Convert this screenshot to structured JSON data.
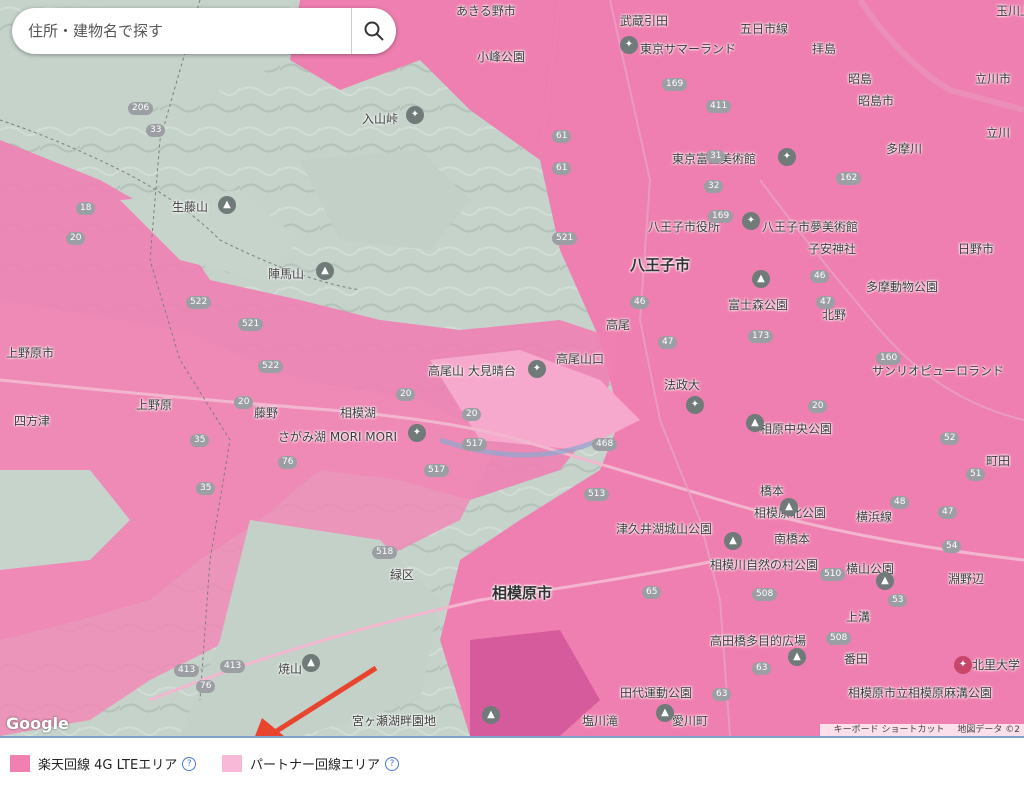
{
  "search": {
    "placeholder": "住所・建物名で探す"
  },
  "colors": {
    "coverage_4g": "#f080b0",
    "partner": "#f8b8d8",
    "arrow": "#e8442e"
  },
  "places": [
    {
      "name": "あきる野市",
      "type": "city-small"
    },
    {
      "name": "武蔵引田",
      "type": "station"
    },
    {
      "name": "五日市線",
      "type": "line"
    },
    {
      "name": "東京サマーランド",
      "type": "poi"
    },
    {
      "name": "拝島",
      "type": "station"
    },
    {
      "name": "昭島",
      "type": "station"
    },
    {
      "name": "昭島市",
      "type": "city-small"
    },
    {
      "name": "立川市",
      "type": "city-small"
    },
    {
      "name": "小峰公園",
      "type": "poi"
    },
    {
      "name": "入山峠",
      "type": "poi"
    },
    {
      "name": "東京富士美術館",
      "type": "poi"
    },
    {
      "name": "生藤山",
      "type": "mountain"
    },
    {
      "name": "八王子市役所",
      "type": "poi"
    },
    {
      "name": "八王子市夢美術館",
      "type": "poi"
    },
    {
      "name": "子安神社",
      "type": "poi"
    },
    {
      "name": "日野市",
      "type": "city-small"
    },
    {
      "name": "陣馬山",
      "type": "mountain"
    },
    {
      "name": "八王子市",
      "type": "city"
    },
    {
      "name": "多摩動物公園",
      "type": "poi"
    },
    {
      "name": "富士森公園",
      "type": "poi"
    },
    {
      "name": "高尾",
      "type": "station"
    },
    {
      "name": "北野",
      "type": "station"
    },
    {
      "name": "上野原市",
      "type": "city-small"
    },
    {
      "name": "高尾山 大見晴台",
      "type": "poi"
    },
    {
      "name": "高尾山口",
      "type": "station"
    },
    {
      "name": "サンリオピューロランド",
      "type": "poi"
    },
    {
      "name": "法政大",
      "type": "poi"
    },
    {
      "name": "上野原",
      "type": "station"
    },
    {
      "name": "藤野",
      "type": "station"
    },
    {
      "name": "相模湖",
      "type": "station"
    },
    {
      "name": "四方津",
      "type": "station"
    },
    {
      "name": "さがみ湖 MORI MORI",
      "type": "poi"
    },
    {
      "name": "相原中央公園",
      "type": "poi"
    },
    {
      "name": "町田",
      "type": "city-small"
    },
    {
      "name": "橋本",
      "type": "station"
    },
    {
      "name": "相模原北公園",
      "type": "poi"
    },
    {
      "name": "横浜線",
      "type": "line"
    },
    {
      "name": "津久井湖城山公園",
      "type": "poi"
    },
    {
      "name": "南橋本",
      "type": "station"
    },
    {
      "name": "相模川自然の村公園",
      "type": "poi"
    },
    {
      "name": "横山公園",
      "type": "poi"
    },
    {
      "name": "淵野辺",
      "type": "station"
    },
    {
      "name": "緑区",
      "type": "ward"
    },
    {
      "name": "相模原市",
      "type": "city"
    },
    {
      "name": "上溝",
      "type": "station"
    },
    {
      "name": "高田橋多目的広場",
      "type": "poi"
    },
    {
      "name": "番田",
      "type": "station"
    },
    {
      "name": "北里大学",
      "type": "poi"
    },
    {
      "name": "焼山",
      "type": "mountain"
    },
    {
      "name": "田代運動公園",
      "type": "poi"
    },
    {
      "name": "相模原市立相模原麻溝公園",
      "type": "poi"
    },
    {
      "name": "宮ヶ瀬湖畔園地",
      "type": "poi"
    },
    {
      "name": "塩川滝",
      "type": "poi"
    },
    {
      "name": "愛川町",
      "type": "city-small"
    },
    {
      "name": "玉川上水",
      "type": "station"
    },
    {
      "name": "立川",
      "type": "station"
    },
    {
      "name": "多摩川",
      "type": "river"
    }
  ],
  "roads": [
    "206",
    "33",
    "18",
    "20",
    "522",
    "521",
    "522",
    "20",
    "413",
    "413",
    "76",
    "35",
    "35",
    "76",
    "518",
    "517",
    "517",
    "20",
    "20",
    "513",
    "468",
    "61",
    "521",
    "61",
    "169",
    "411",
    "32",
    "31",
    "162",
    "169",
    "46",
    "47",
    "173",
    "160",
    "47",
    "46",
    "20",
    "48",
    "47",
    "65",
    "510",
    "508",
    "63",
    "63",
    "508",
    "53",
    "54",
    "51",
    "52"
  ],
  "attribution": {
    "google": "Google",
    "shortcuts": "キーボード ショートカット",
    "map_data": "地図データ ©2"
  },
  "legend": [
    {
      "label": "楽天回線 4G LTEエリア",
      "color": "#f080b0"
    },
    {
      "label": "パートナー回線エリア",
      "color": "#f8b8d8"
    }
  ],
  "help_glyph": "?"
}
